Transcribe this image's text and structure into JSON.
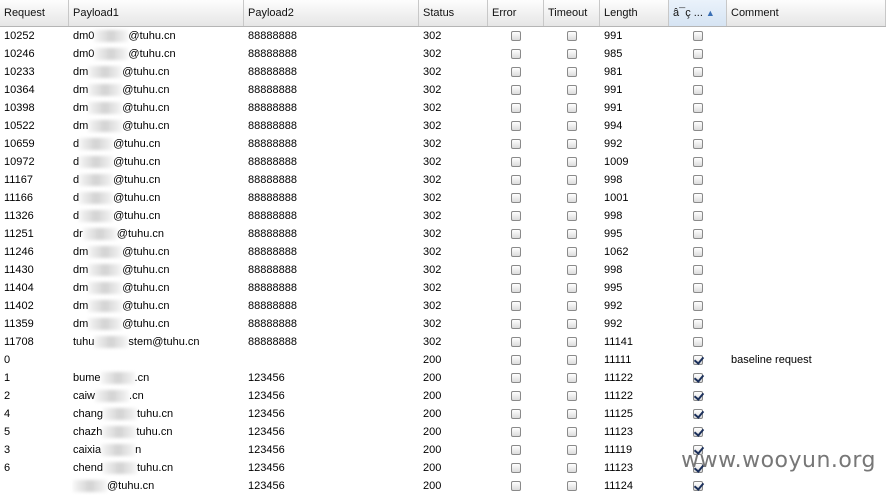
{
  "columns": [
    "Request",
    "Payload1",
    "Payload2",
    "Status",
    "Error",
    "Timeout",
    "Length",
    "â¯ç ...",
    "Comment"
  ],
  "rows": [
    {
      "request": "10252",
      "p1_pre": "dm0",
      "p1_post": "@tuhu.cn",
      "payload2": "88888888",
      "status": "302",
      "length": "991",
      "error": false,
      "timeout": false,
      "marked": false,
      "comment": ""
    },
    {
      "request": "10246",
      "p1_pre": "dm0",
      "p1_post": "@tuhu.cn",
      "payload2": "88888888",
      "status": "302",
      "length": "985",
      "error": false,
      "timeout": false,
      "marked": false,
      "comment": ""
    },
    {
      "request": "10233",
      "p1_pre": "dm",
      "p1_post": "@tuhu.cn",
      "payload2": "88888888",
      "status": "302",
      "length": "981",
      "error": false,
      "timeout": false,
      "marked": false,
      "comment": ""
    },
    {
      "request": "10364",
      "p1_pre": "dm",
      "p1_post": "@tuhu.cn",
      "payload2": "88888888",
      "status": "302",
      "length": "991",
      "error": false,
      "timeout": false,
      "marked": false,
      "comment": ""
    },
    {
      "request": "10398",
      "p1_pre": "dm",
      "p1_post": "@tuhu.cn",
      "payload2": "88888888",
      "status": "302",
      "length": "991",
      "error": false,
      "timeout": false,
      "marked": false,
      "comment": ""
    },
    {
      "request": "10522",
      "p1_pre": "dm",
      "p1_post": "@tuhu.cn",
      "payload2": "88888888",
      "status": "302",
      "length": "994",
      "error": false,
      "timeout": false,
      "marked": false,
      "comment": ""
    },
    {
      "request": "10659",
      "p1_pre": "d",
      "p1_post": "@tuhu.cn",
      "payload2": "88888888",
      "status": "302",
      "length": "992",
      "error": false,
      "timeout": false,
      "marked": false,
      "comment": ""
    },
    {
      "request": "10972",
      "p1_pre": "d",
      "p1_post": "@tuhu.cn",
      "payload2": "88888888",
      "status": "302",
      "length": "1009",
      "error": false,
      "timeout": false,
      "marked": false,
      "comment": ""
    },
    {
      "request": "11167",
      "p1_pre": "d",
      "p1_post": "@tuhu.cn",
      "payload2": "88888888",
      "status": "302",
      "length": "998",
      "error": false,
      "timeout": false,
      "marked": false,
      "comment": ""
    },
    {
      "request": "11166",
      "p1_pre": "d",
      "p1_post": "@tuhu.cn",
      "payload2": "88888888",
      "status": "302",
      "length": "1001",
      "error": false,
      "timeout": false,
      "marked": false,
      "comment": ""
    },
    {
      "request": "11326",
      "p1_pre": "d",
      "p1_post": "@tuhu.cn",
      "payload2": "88888888",
      "status": "302",
      "length": "998",
      "error": false,
      "timeout": false,
      "marked": false,
      "comment": ""
    },
    {
      "request": "11251",
      "p1_pre": "dr",
      "p1_post": "@tuhu.cn",
      "payload2": "88888888",
      "status": "302",
      "length": "995",
      "error": false,
      "timeout": false,
      "marked": false,
      "comment": ""
    },
    {
      "request": "11246",
      "p1_pre": "dm",
      "p1_post": "@tuhu.cn",
      "payload2": "88888888",
      "status": "302",
      "length": "1062",
      "error": false,
      "timeout": false,
      "marked": false,
      "comment": ""
    },
    {
      "request": "11430",
      "p1_pre": "dm",
      "p1_post": "@tuhu.cn",
      "payload2": "88888888",
      "status": "302",
      "length": "998",
      "error": false,
      "timeout": false,
      "marked": false,
      "comment": ""
    },
    {
      "request": "11404",
      "p1_pre": "dm",
      "p1_post": "@tuhu.cn",
      "payload2": "88888888",
      "status": "302",
      "length": "995",
      "error": false,
      "timeout": false,
      "marked": false,
      "comment": ""
    },
    {
      "request": "11402",
      "p1_pre": "dm",
      "p1_post": "@tuhu.cn",
      "payload2": "88888888",
      "status": "302",
      "length": "992",
      "error": false,
      "timeout": false,
      "marked": false,
      "comment": ""
    },
    {
      "request": "11359",
      "p1_pre": "dm",
      "p1_post": "@tuhu.cn",
      "payload2": "88888888",
      "status": "302",
      "length": "992",
      "error": false,
      "timeout": false,
      "marked": false,
      "comment": ""
    },
    {
      "request": "11708",
      "p1_pre": "tuhu",
      "p1_post": "stem@tuhu.cn",
      "payload2": "88888888",
      "status": "302",
      "length": "11141",
      "error": false,
      "timeout": false,
      "marked": false,
      "comment": ""
    },
    {
      "request": "0",
      "p1_pre": "",
      "p1_post": "",
      "payload2": "",
      "status": "200",
      "length": "11111",
      "error": false,
      "timeout": false,
      "marked": true,
      "comment": "baseline request"
    },
    {
      "request": "1",
      "p1_pre": "bume",
      "p1_post": ".cn",
      "payload2": "123456",
      "status": "200",
      "length": "11122",
      "error": false,
      "timeout": false,
      "marked": true,
      "comment": ""
    },
    {
      "request": "2",
      "p1_pre": "caiw",
      "p1_post": ".cn",
      "payload2": "123456",
      "status": "200",
      "length": "11122",
      "error": false,
      "timeout": false,
      "marked": true,
      "comment": ""
    },
    {
      "request": "4",
      "p1_pre": "chang",
      "p1_post": "tuhu.cn",
      "payload2": "123456",
      "status": "200",
      "length": "11125",
      "error": false,
      "timeout": false,
      "marked": true,
      "comment": ""
    },
    {
      "request": "5",
      "p1_pre": "chazh",
      "p1_post": "tuhu.cn",
      "payload2": "123456",
      "status": "200",
      "length": "11123",
      "error": false,
      "timeout": false,
      "marked": true,
      "comment": ""
    },
    {
      "request": "3",
      "p1_pre": "caixia",
      "p1_post": "n",
      "payload2": "123456",
      "status": "200",
      "length": "11119",
      "error": false,
      "timeout": false,
      "marked": true,
      "comment": ""
    },
    {
      "request": "6",
      "p1_pre": "chend",
      "p1_post": "tuhu.cn",
      "payload2": "123456",
      "status": "200",
      "length": "11123",
      "error": false,
      "timeout": false,
      "marked": true,
      "comment": ""
    },
    {
      "request": "",
      "p1_pre": "",
      "p1_post": "@tuhu.cn",
      "payload2": "123456",
      "status": "200",
      "length": "11124",
      "error": false,
      "timeout": false,
      "marked": true,
      "comment": ""
    }
  ],
  "watermark": "www.wooyun.org"
}
